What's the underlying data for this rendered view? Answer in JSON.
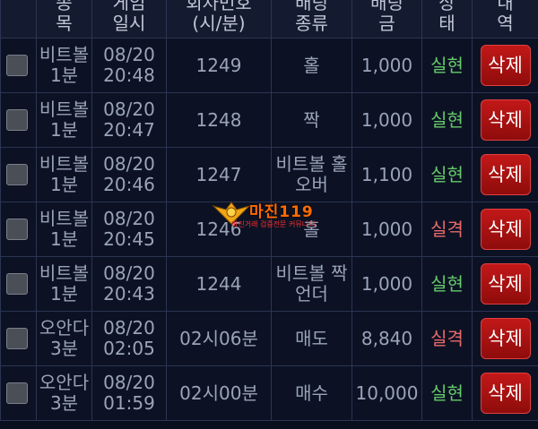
{
  "header": {
    "columns": [
      {
        "lines": [
          "",
          ""
        ]
      },
      {
        "lines": [
          "종",
          "목"
        ]
      },
      {
        "lines": [
          "게임",
          "일시"
        ]
      },
      {
        "lines": [
          "회차번호",
          "(시/분)"
        ]
      },
      {
        "lines": [
          "배팅",
          "종류"
        ]
      },
      {
        "lines": [
          "배팅",
          "금"
        ]
      },
      {
        "lines": [
          "상",
          "태"
        ]
      },
      {
        "lines": [
          "내",
          "역"
        ]
      }
    ]
  },
  "rows": [
    {
      "game": [
        "비트볼",
        "1분"
      ],
      "time": [
        "08/20",
        "20:48"
      ],
      "round": "1249",
      "type": [
        "홀"
      ],
      "amount": "1,000",
      "status": "실현",
      "status_kind": "win",
      "delete_label": "삭제"
    },
    {
      "game": [
        "비트볼",
        "1분"
      ],
      "time": [
        "08/20",
        "20:47"
      ],
      "round": "1248",
      "type": [
        "짝"
      ],
      "amount": "1,000",
      "status": "실현",
      "status_kind": "win",
      "delete_label": "삭제"
    },
    {
      "game": [
        "비트볼",
        "1분"
      ],
      "time": [
        "08/20",
        "20:46"
      ],
      "round": "1247",
      "type": [
        "비트볼 홀",
        "오버"
      ],
      "amount": "1,100",
      "status": "실현",
      "status_kind": "win",
      "delete_label": "삭제"
    },
    {
      "game": [
        "비트볼",
        "1분"
      ],
      "time": [
        "08/20",
        "20:45"
      ],
      "round": "1246",
      "type": [
        "홀"
      ],
      "amount": "1,000",
      "status": "실격",
      "status_kind": "loss",
      "delete_label": "삭제"
    },
    {
      "game": [
        "비트볼",
        "1분"
      ],
      "time": [
        "08/20",
        "20:43"
      ],
      "round": "1244",
      "type": [
        "비트볼 짝",
        "언더"
      ],
      "amount": "1,000",
      "status": "실현",
      "status_kind": "win",
      "delete_label": "삭제"
    },
    {
      "game": [
        "오안다",
        "3분"
      ],
      "time": [
        "08/20",
        "02:05"
      ],
      "round": "02시06분",
      "type": [
        "매도"
      ],
      "amount": "8,840",
      "status": "실격",
      "status_kind": "loss",
      "delete_label": "삭제"
    },
    {
      "game": [
        "오안다",
        "3분"
      ],
      "time": [
        "08/20",
        "01:59"
      ],
      "round": "02시00분",
      "type": [
        "매수"
      ],
      "amount": "10,000",
      "status": "실현",
      "status_kind": "win",
      "delete_label": "삭제"
    }
  ],
  "watermark": {
    "title": "마진119",
    "subtitle": "마진거래 검증전문 커뮤니티"
  },
  "colors": {
    "background": "#0a0f1e",
    "win": "#66c96a",
    "loss": "#e86a6a",
    "delete_button": "#b01212"
  }
}
